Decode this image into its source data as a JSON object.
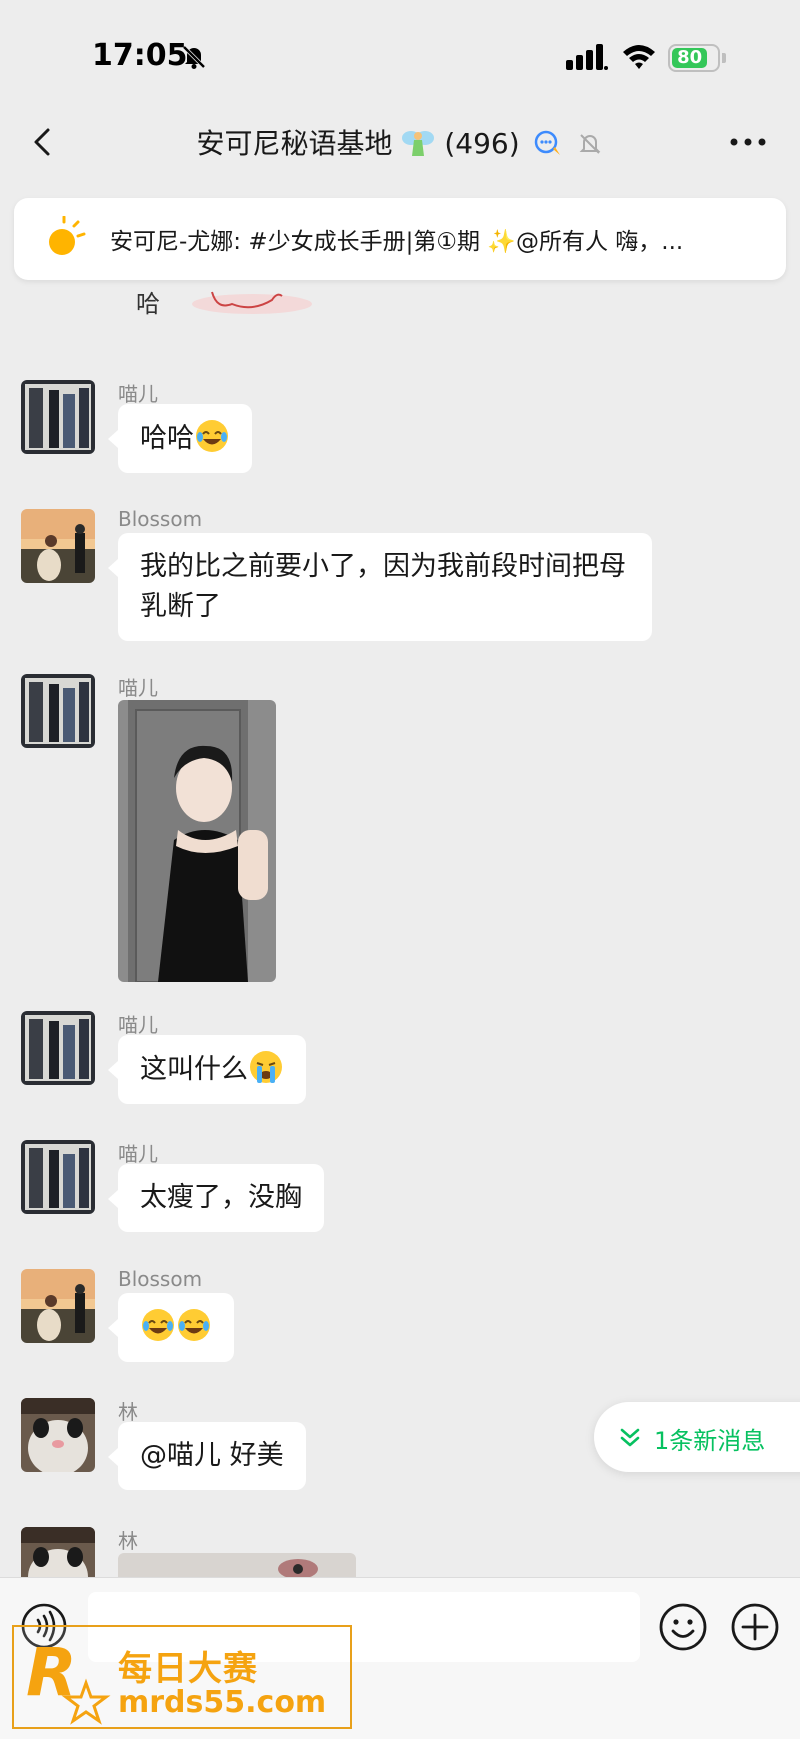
{
  "status_bar": {
    "time": "17:05",
    "battery": "80"
  },
  "header": {
    "title": "安可尼秘语基地",
    "count": "(496)"
  },
  "announcement": {
    "text": "安可尼-尤娜: #少女成长手册|第①期 ✨@所有人  嗨，..."
  },
  "messages": [
    {
      "sender": "喵儿",
      "text": "哈哈",
      "emoji": "laughing-crying-emoji"
    },
    {
      "sender": "Blossom",
      "text": "我的比之前要小了，因为我前段时间把母乳断了"
    },
    {
      "sender": "喵儿",
      "type": "image"
    },
    {
      "sender": "喵儿",
      "text": "这叫什么",
      "emoji": "loudly-crying-emoji"
    },
    {
      "sender": "喵儿",
      "text": "太瘦了，没胸"
    },
    {
      "sender": "Blossom",
      "emoji": "laughing-crying-emoji x2"
    },
    {
      "sender": "林",
      "text": "@喵儿 好美"
    },
    {
      "sender": "林",
      "type": "image-partial"
    }
  ],
  "new_messages": {
    "label": "1条新消息"
  },
  "watermark": {
    "line1": "每日大赛",
    "line2": "mrds55.com"
  },
  "colors": {
    "accent": "#07c160",
    "background": "#ededed",
    "bubble": "#ffffff",
    "watermark": "#f5a310"
  }
}
